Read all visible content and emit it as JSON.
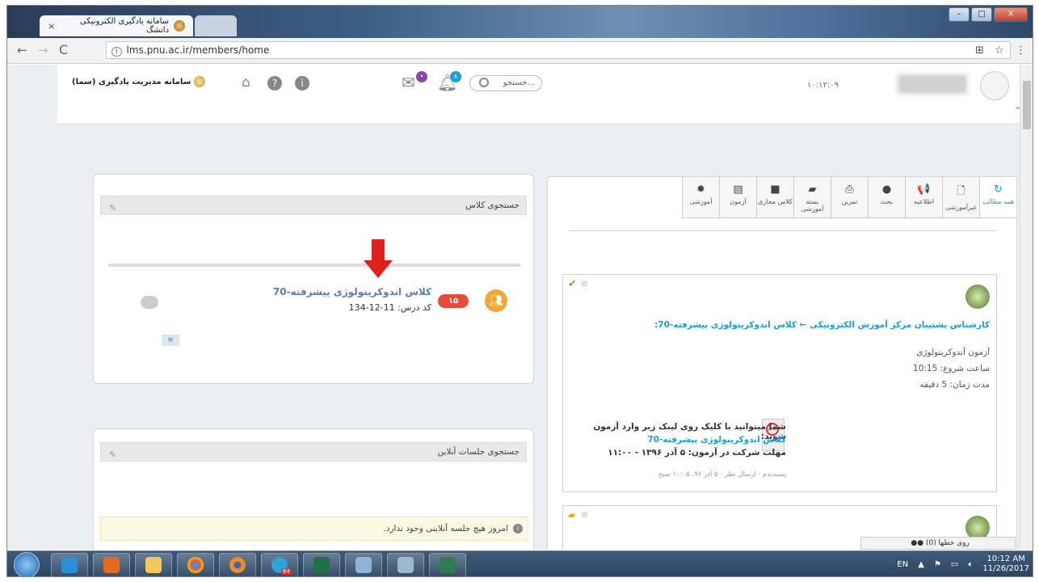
{
  "browser": {
    "tab_title": "سامانه یادگیری الکترونیکی دانشگ",
    "tab_close": "×",
    "url": "lms.pnu.ac.ir/members/home",
    "win_min": "–",
    "win_max": "□",
    "win_close": "X"
  },
  "header": {
    "logo_text": "سامانه مدیریت یادگیری (سما)",
    "search_placeholder": "جستجو...",
    "notif_count": "۸",
    "msg_count": "•",
    "date": "۱۰:۱۲:۰۹"
  },
  "class_search": {
    "header": "جستجوی کلاس",
    "class_title": "کلاس اندوکرینولوژی پیشرفته-70",
    "class_code": "کد درس: 11-12-134",
    "badge": "۱۵"
  },
  "online_sessions": {
    "header": "جستجوی جلسات آنلاین",
    "notice": "امروز هیچ جلسه آنلاینی وجود ندارد."
  },
  "right_tabs": [
    {
      "label": "همه مطالب",
      "icon": "refresh-icon",
      "glyph": "↻"
    },
    {
      "label": "غیرآموزشی",
      "icon": "file-icon",
      "glyph": "🗋"
    },
    {
      "label": "اطلاعیه",
      "icon": "megaphone-icon",
      "glyph": "📢"
    },
    {
      "label": "بحث",
      "icon": "comment-icon",
      "glyph": "●"
    },
    {
      "label": "تمرین",
      "icon": "printer-icon",
      "glyph": "⎙"
    },
    {
      "label": "بسته آموزشی",
      "icon": "folder-icon",
      "glyph": "▰"
    },
    {
      "label": "کلاس مجازی",
      "icon": "video-icon",
      "glyph": "■"
    },
    {
      "label": "آزمون",
      "icon": "book-icon",
      "glyph": "▤"
    },
    {
      "label": "آموزشی",
      "icon": "gear-icon",
      "glyph": "✹"
    }
  ],
  "post": {
    "author_line": "کارشناس پشتیبان مرکز آموزش الکترونیکی ← کلاس اندوکرینولوژی پیشرفته-70:",
    "exam_title": "آزمون آندوکرینولوژی",
    "start_time": "ساعت شروع: 10:15",
    "duration": "مدت زمان: 5 دقیقه",
    "enter_text": "شما میتوانید با کلیک روی لینک زیر وارد آزمون شوید:",
    "exam_link": "کلاس اندوکرینولوژی پیشرفته-70",
    "deadline": "مهلت شرکت در آزمون: ۵ آذر ۱۳۹۶ - ۱۱:۰۰",
    "footer": "پسندیدم · ارسال نظر · ۵ آذر ۹۶، ۱۰:۰۵ صبح"
  },
  "online_bar": {
    "label": "روی خطها (0)"
  },
  "taskbar": {
    "lang": "EN",
    "time": "10:12 AM",
    "date": "11/26/2017",
    "telegram_badge": "64"
  },
  "colors": {
    "accent": "#1a9fd6",
    "badge_red": "#e84b3c",
    "arrow_red": "#e0201c",
    "group_orange": "#f0a830"
  }
}
